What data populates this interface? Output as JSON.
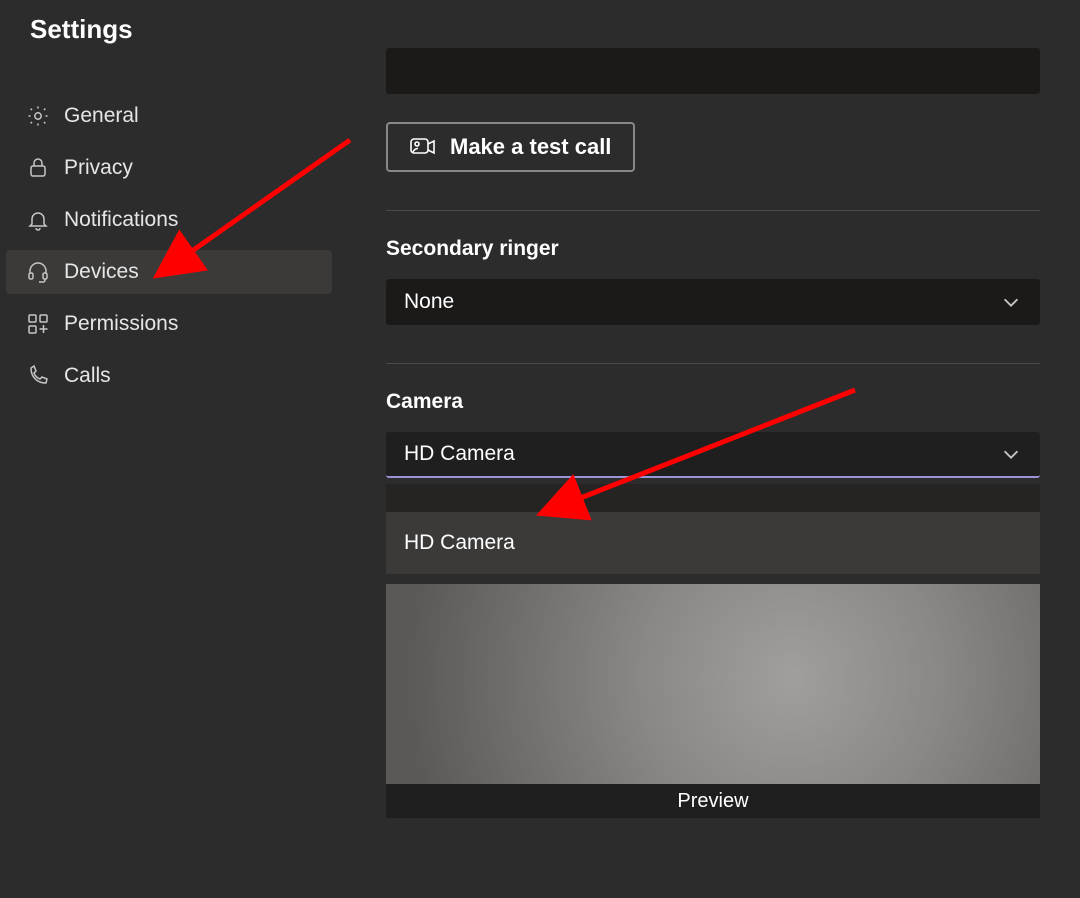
{
  "title": "Settings",
  "sidebar": {
    "items": [
      {
        "label": "General",
        "icon": "gear-icon",
        "active": false
      },
      {
        "label": "Privacy",
        "icon": "lock-icon",
        "active": false
      },
      {
        "label": "Notifications",
        "icon": "bell-icon",
        "active": false
      },
      {
        "label": "Devices",
        "icon": "headset-icon",
        "active": true
      },
      {
        "label": "Permissions",
        "icon": "apps-icon",
        "active": false
      },
      {
        "label": "Calls",
        "icon": "phone-icon",
        "active": false
      }
    ]
  },
  "main": {
    "test_call_label": "Make a test call",
    "secondary_ringer": {
      "label": "Secondary ringer",
      "value": "None"
    },
    "camera": {
      "label": "Camera",
      "value": "HD Camera",
      "options": [
        "HD Camera"
      ],
      "preview_label": "Preview"
    }
  }
}
